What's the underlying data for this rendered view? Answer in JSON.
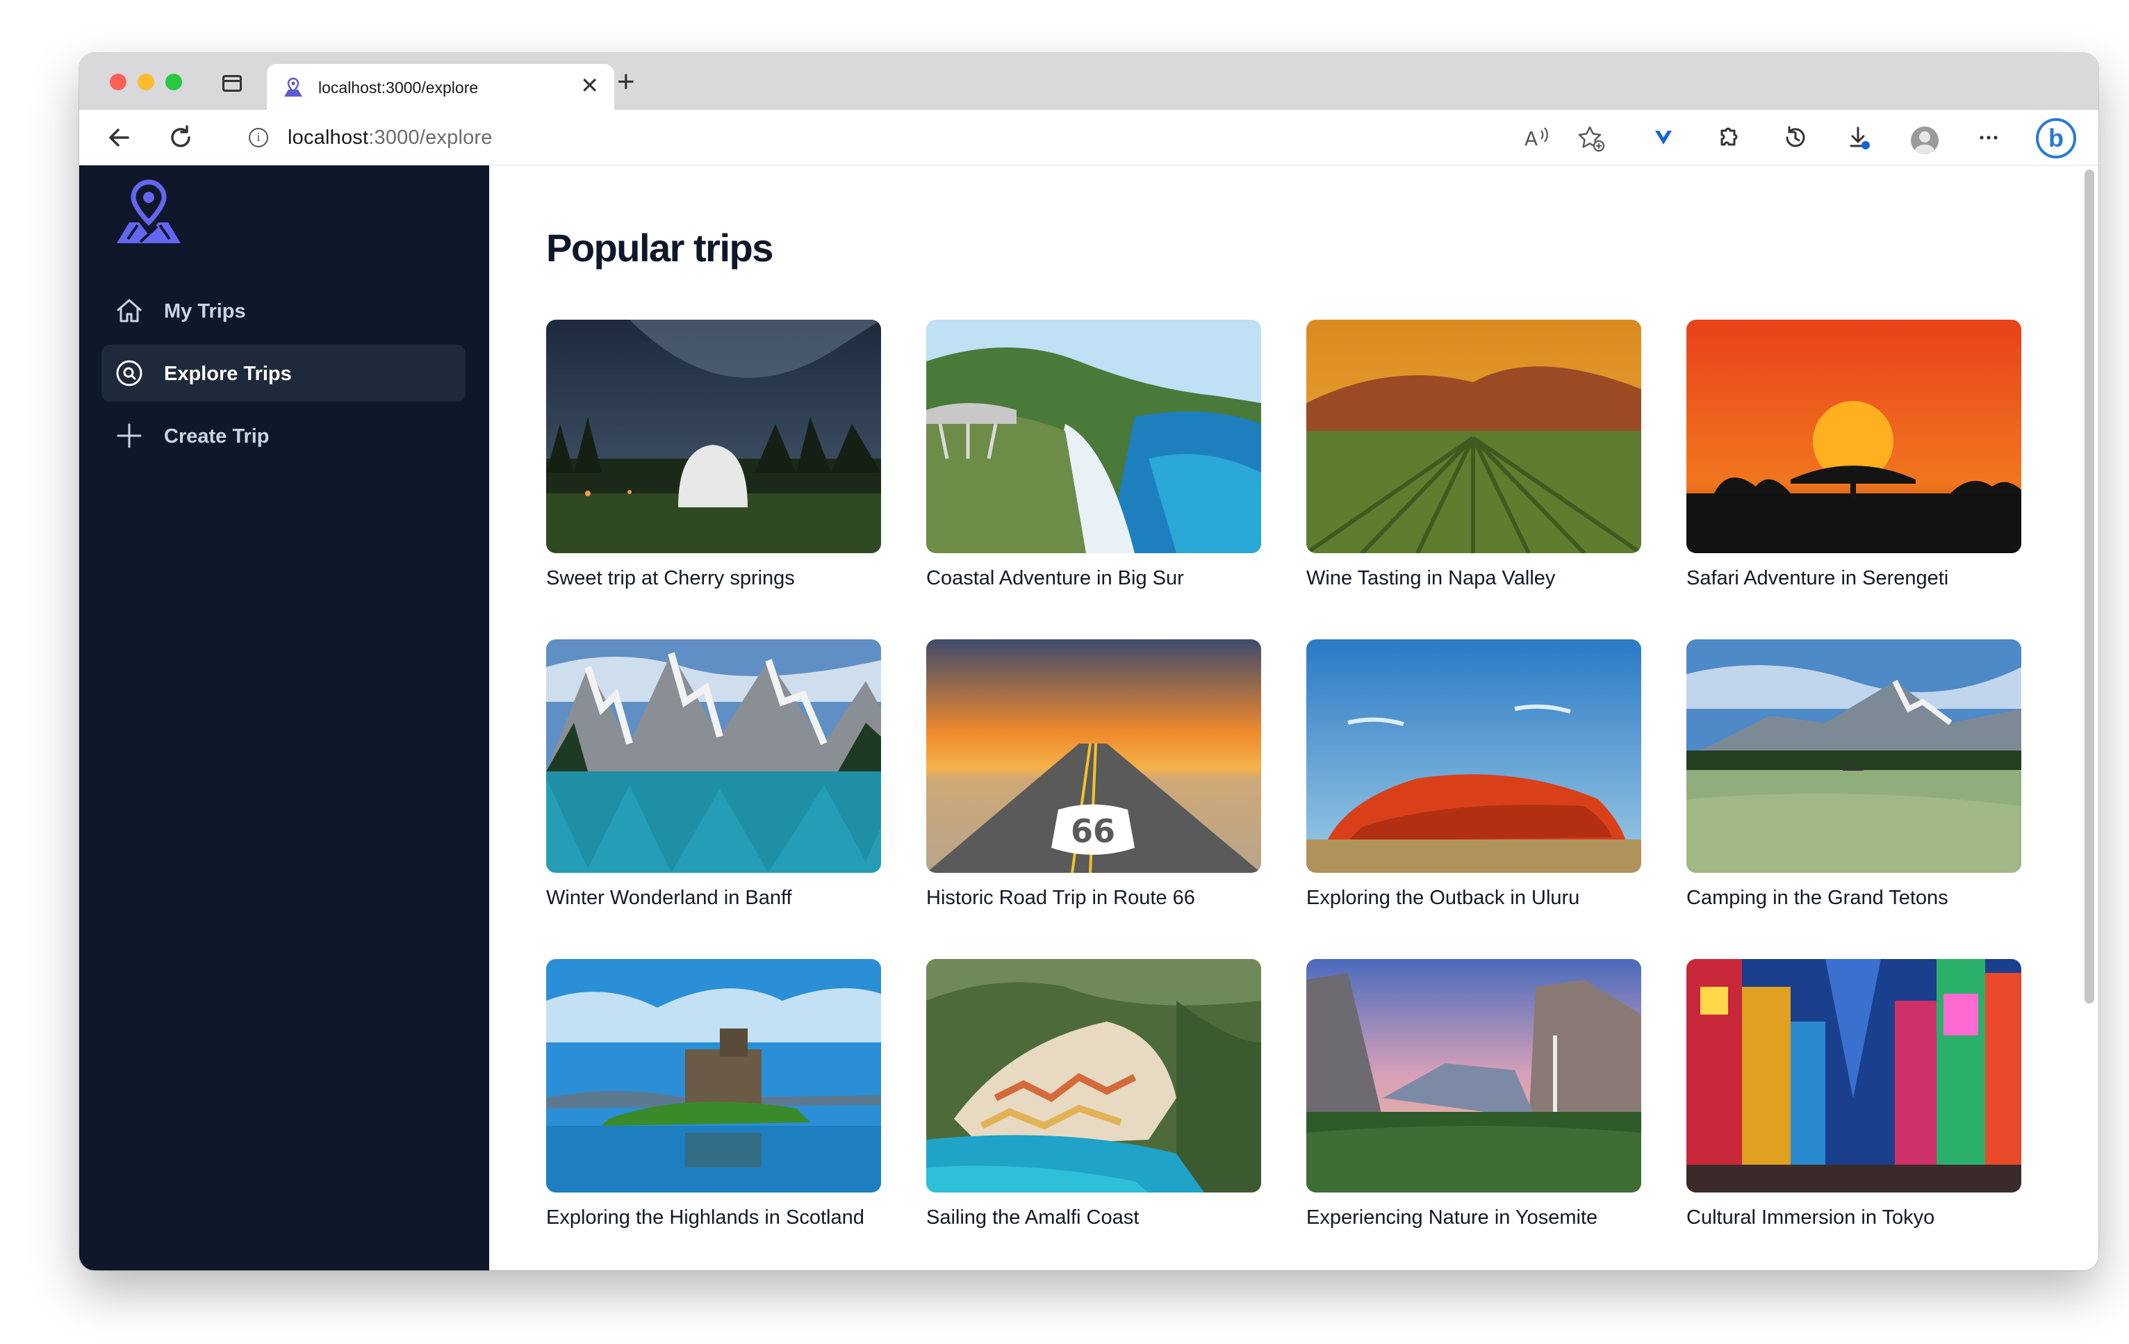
{
  "browser": {
    "tab_title": "localhost:3000/explore",
    "url_host": "localhost",
    "url_rest": ":3000/explore"
  },
  "sidebar": {
    "items": [
      {
        "label": "My Trips",
        "icon": "home-icon",
        "active": false
      },
      {
        "label": "Explore Trips",
        "icon": "explore-icon",
        "active": true
      },
      {
        "label": "Create Trip",
        "icon": "plus-icon",
        "active": false
      }
    ]
  },
  "main": {
    "title": "Popular trips",
    "trips": [
      {
        "title": "Sweet trip at Cherry springs"
      },
      {
        "title": "Coastal Adventure in Big Sur"
      },
      {
        "title": "Wine Tasting in Napa Valley"
      },
      {
        "title": "Safari Adventure in Serengeti"
      },
      {
        "title": "Winter Wonderland in Banff"
      },
      {
        "title": "Historic Road Trip in Route 66"
      },
      {
        "title": "Exploring the Outback in Uluru"
      },
      {
        "title": "Camping in the Grand Tetons"
      },
      {
        "title": "Exploring the Highlands in Scotland"
      },
      {
        "title": "Sailing the Amalfi Coast"
      },
      {
        "title": "Experiencing Nature in Yosemite"
      },
      {
        "title": "Cultural Immersion in Tokyo"
      }
    ]
  },
  "colors": {
    "sidebar_bg": "#0f172a",
    "active_item_bg": "#1e293b",
    "logo_accent": "#6366f1"
  }
}
